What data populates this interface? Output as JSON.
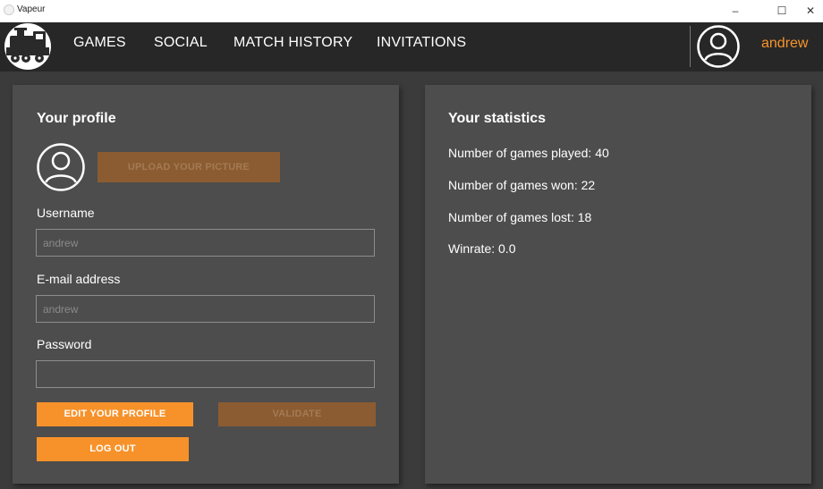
{
  "window": {
    "title": "Vapeur",
    "minimize_glyph": "–",
    "maximize_glyph": "☐",
    "close_glyph": "✕"
  },
  "nav": {
    "logo_icon": "train-icon",
    "items": [
      {
        "label": "GAMES"
      },
      {
        "label": "SOCIAL"
      },
      {
        "label": "MATCH HISTORY"
      },
      {
        "label": "INVITATIONS"
      }
    ],
    "user_avatar_icon": "user-avatar-icon",
    "username": "andrew"
  },
  "profile": {
    "title": "Your profile",
    "avatar_icon": "user-avatar-icon",
    "upload_label": "UPLOAD YOUR PICTURE",
    "username_label": "Username",
    "username_value": "andrew",
    "email_label": "E-mail address",
    "email_value": "andrew",
    "password_label": "Password",
    "password_value": "",
    "edit_label": "EDIT YOUR PROFILE",
    "validate_label": "VALIDATE",
    "logout_label": "LOG OUT"
  },
  "stats": {
    "title": "Your statistics",
    "played": "Number of games played: 40",
    "won": "Number of games won: 22",
    "lost": "Number of games lost: 18",
    "winrate": "Winrate: 0.0"
  },
  "colors": {
    "accent": "#f7942a",
    "accent_disabled": "#8b5c31",
    "panel": "#4d4d4d",
    "background": "#3b3b3b",
    "navbar": "#272727"
  }
}
